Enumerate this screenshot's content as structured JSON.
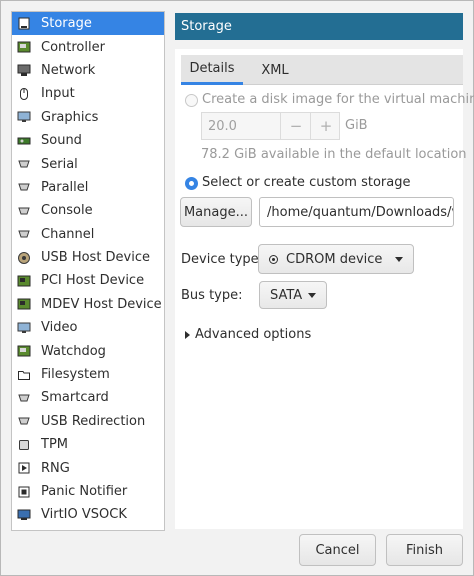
{
  "sidebar": {
    "items": [
      {
        "label": "Storage",
        "icon": "storage-icon",
        "selected": true
      },
      {
        "label": "Controller",
        "icon": "controller-icon"
      },
      {
        "label": "Network",
        "icon": "network-icon"
      },
      {
        "label": "Input",
        "icon": "mouse-icon"
      },
      {
        "label": "Graphics",
        "icon": "monitor-icon"
      },
      {
        "label": "Sound",
        "icon": "sound-card-icon"
      },
      {
        "label": "Serial",
        "icon": "serial-port-icon"
      },
      {
        "label": "Parallel",
        "icon": "parallel-port-icon"
      },
      {
        "label": "Console",
        "icon": "console-port-icon"
      },
      {
        "label": "Channel",
        "icon": "channel-port-icon"
      },
      {
        "label": "USB Host Device",
        "icon": "usb-device-icon"
      },
      {
        "label": "PCI Host Device",
        "icon": "pci-card-icon"
      },
      {
        "label": "MDEV Host Device",
        "icon": "mdev-card-icon"
      },
      {
        "label": "Video",
        "icon": "video-icon"
      },
      {
        "label": "Watchdog",
        "icon": "watchdog-icon"
      },
      {
        "label": "Filesystem",
        "icon": "folder-icon"
      },
      {
        "label": "Smartcard",
        "icon": "smartcard-icon"
      },
      {
        "label": "USB Redirection",
        "icon": "usb-redirection-icon"
      },
      {
        "label": "TPM",
        "icon": "chip-icon"
      },
      {
        "label": "RNG",
        "icon": "rng-icon"
      },
      {
        "label": "Panic Notifier",
        "icon": "panic-notifier-icon"
      },
      {
        "label": "VirtIO VSOCK",
        "icon": "vsock-icon"
      }
    ]
  },
  "header": {
    "title": "Storage"
  },
  "tabs": {
    "details": "Details",
    "xml": "XML"
  },
  "storage": {
    "create_image_label": "Create a disk image for the virtual machine",
    "size_value": "20.0",
    "size_unit": "GiB",
    "minus": "−",
    "plus": "+",
    "available_text": "78.2 GiB available in the default location",
    "custom_storage_label": "Select or create custom storage",
    "manage_label": "Manage...",
    "path_value": "/home/quantum/Downloads/v",
    "device_type_label": "Device type:",
    "device_type_value": "CDROM device",
    "bus_type_label": "Bus type:",
    "bus_type_value": "SATA",
    "advanced_label": "Advanced options"
  },
  "footer": {
    "cancel_label": "Cancel",
    "finish_label": "Finish"
  },
  "colors": {
    "accent": "#3584e4",
    "header_bg": "#236e93"
  }
}
